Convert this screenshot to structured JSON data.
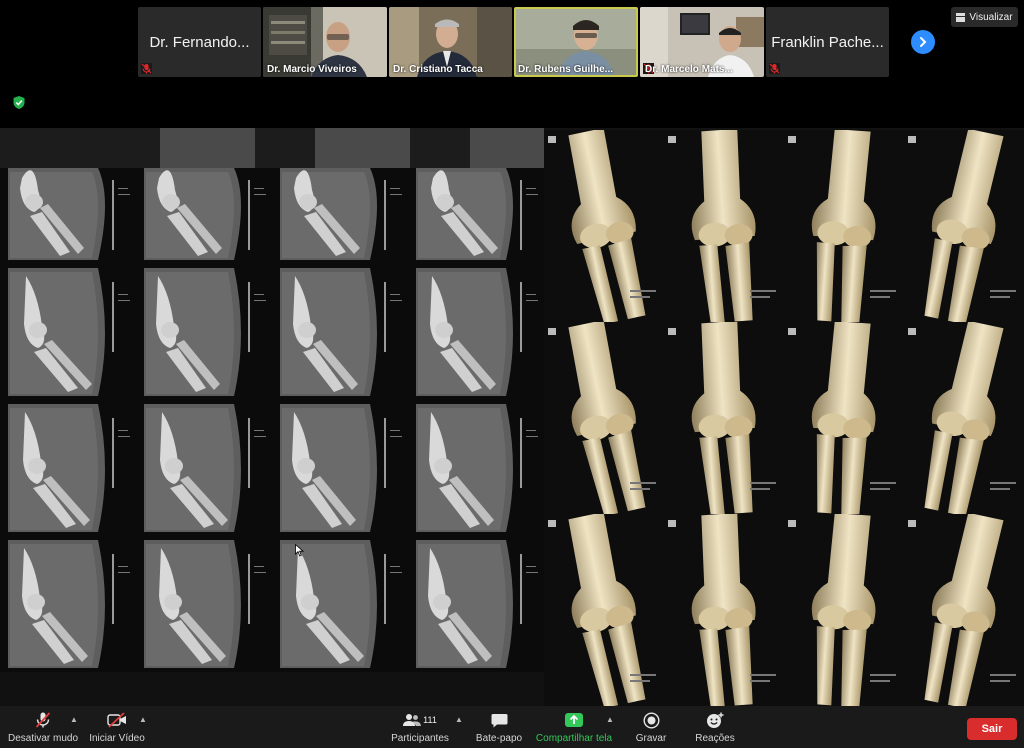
{
  "participants": [
    {
      "name": "Dr. Fernando...",
      "video": false,
      "muted": true
    },
    {
      "name": "Dr. Marcio Viveiros",
      "video": true
    },
    {
      "name": "Dr. Cristiano Tacca",
      "video": true
    },
    {
      "name": "Dr. Rubens Guilhe...",
      "video": true,
      "active_speaker": true
    },
    {
      "name": "Dr. Marcelo Mats...",
      "video": true,
      "muted": true
    },
    {
      "name": "Franklin Pache...",
      "video": false
    }
  ],
  "view_button": {
    "label": "Visualizar",
    "icon": "grid-icon"
  },
  "next_page_icon": "chevron-right-icon",
  "toolbar": {
    "mute": {
      "label": "Desativar mudo",
      "icon": "microphone-muted-icon"
    },
    "video": {
      "label": "Iniciar Vídeo",
      "icon": "video-off-icon"
    },
    "participants": {
      "label": "Participantes",
      "count": "111",
      "icon": "people-icon"
    },
    "chat": {
      "label": "Bate-papo",
      "icon": "chat-icon"
    },
    "share": {
      "label": "Compartilhar tela",
      "icon": "share-screen-icon"
    },
    "record": {
      "label": "Gravar",
      "icon": "record-icon"
    },
    "reactions": {
      "label": "Reações",
      "icon": "reaction-icon"
    },
    "leave": {
      "label": "Sair"
    }
  },
  "colors": {
    "accent_blue": "#2d8cff",
    "leave_red": "#d92d2d",
    "share_green": "#34c759",
    "active_border": "#c9c94b"
  }
}
